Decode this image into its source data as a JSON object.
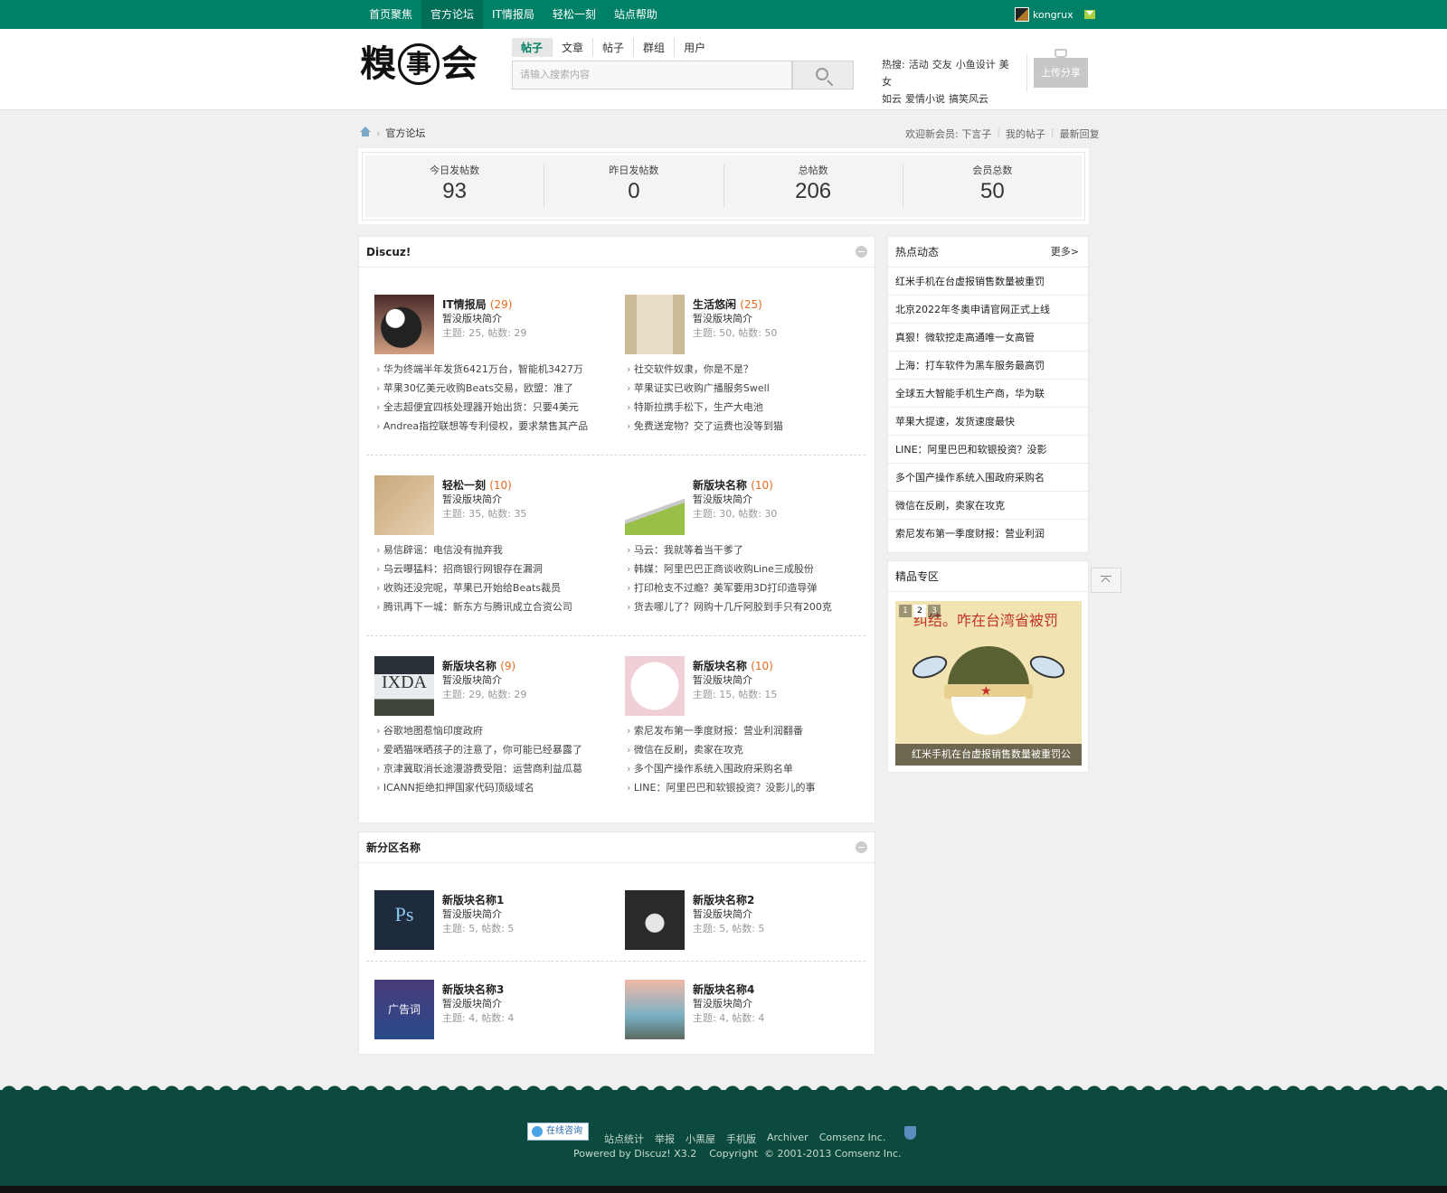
{
  "topnav": {
    "items": [
      "首页聚焦",
      "官方论坛",
      "IT情报局",
      "轻松一刻",
      "站点帮助"
    ],
    "active_index": 1,
    "username": "kongrux"
  },
  "header": {
    "logo_chars": [
      "糗",
      "事",
      "会"
    ],
    "search_tabs": [
      "帖子",
      "文章",
      "帖子",
      "群组",
      "用户"
    ],
    "search_placeholder": "请输入搜索内容",
    "hot_label": "热搜:",
    "hot_terms": [
      "活动",
      "交友",
      "小鱼设计",
      "美女",
      "如云",
      "爱情小说",
      "搞笑风云"
    ],
    "upload_label": "上传分享"
  },
  "breadcrumb": {
    "current": "官方论坛",
    "welcome": "欢迎新会员: 下言子",
    "my_posts": "我的帖子",
    "latest_replies": "最新回复"
  },
  "stats": [
    {
      "label": "今日发帖数",
      "value": "93"
    },
    {
      "label": "昨日发帖数",
      "value": "0"
    },
    {
      "label": "总帖数",
      "value": "206"
    },
    {
      "label": "会员总数",
      "value": "50"
    }
  ],
  "discuz": {
    "title": "Discuz!",
    "forums": [
      {
        "name": "IT情报局",
        "count": "(29)",
        "desc": "暂没版块简介",
        "meta": "主题: 25, 帖数: 29",
        "threads": [
          "华为终端半年发货6421万台，智能机3427万",
          "苹果30亿美元收购Beats交易，欧盟：准了",
          "全志超便宜四核处理器开始出货：只要4美元",
          "Andrea指控联想等专利侵权，要求禁售其产品"
        ]
      },
      {
        "name": "生活悠闲",
        "count": "(25)",
        "desc": "暂没版块简介",
        "meta": "主题: 50, 帖数: 50",
        "threads": [
          "社交软件奴隶，你是不是？",
          "苹果证实已收购广播服务Swell",
          "特斯拉携手松下，生产大电池",
          "免费送宠物？交了运费也没等到猫"
        ]
      },
      {
        "name": "轻松一刻",
        "count": "(10)",
        "desc": "暂没版块简介",
        "meta": "主题: 35, 帖数: 35",
        "threads": [
          "易信辟谣：电信没有抛弃我",
          "乌云曝猛料：招商银行网银存在漏洞",
          "收购还没完呢，苹果已开始给Beats裁员",
          "腾讯再下一城：新东方与腾讯成立合资公司"
        ]
      },
      {
        "name": "新版块名称",
        "count": "(10)",
        "desc": "暂没版块简介",
        "meta": "主题: 30, 帖数: 30",
        "threads": [
          "马云：我就等着当干爹了",
          "韩媒：阿里巴巴正商谈收购Line三成股份",
          "打印枪支不过瘾？美军要用3D打印造导弹",
          "货去哪儿了？网购十几斤阿胶到手只有200克"
        ]
      },
      {
        "name": "新版块名称",
        "count": "(9)",
        "desc": "暂没版块简介",
        "meta": "主题: 29, 帖数: 29",
        "threads": [
          "谷歌地图惹恼印度政府",
          "爱晒猫咪晒孩子的注意了，你可能已经暴露了",
          "京津冀取消长途漫游费受阻：运营商利益瓜葛",
          "ICANN拒绝扣押国家代码顶级域名"
        ]
      },
      {
        "name": "新版块名称",
        "count": "(10)",
        "desc": "暂没版块简介",
        "meta": "主题: 15, 帖数: 15",
        "threads": [
          "索尼发布第一季度财报：营业利润翻番",
          "微信在反刷，卖家在攻克",
          "多个国产操作系统入围政府采购名单",
          "LINE：阿里巴巴和软银投资？没影儿的事"
        ]
      }
    ]
  },
  "newzone": {
    "title": "新分区名称",
    "forums": [
      {
        "name": "新版块名称1",
        "desc": "暂没版块简介",
        "meta": "主题: 5, 帖数: 5",
        "thumb_text": "Ps"
      },
      {
        "name": "新版块名称2",
        "desc": "暂没版块简介",
        "meta": "主题: 5, 帖数: 5",
        "thumb_text": ""
      },
      {
        "name": "新版块名称3",
        "desc": "暂没版块简介",
        "meta": "主题: 4, 帖数: 4",
        "thumb_text": "广告词"
      },
      {
        "name": "新版块名称4",
        "desc": "暂没版块简介",
        "meta": "主题: 4, 帖数: 4",
        "thumb_text": ""
      }
    ]
  },
  "sidebar": {
    "hot_title": "热点动态",
    "more_label": "更多>",
    "hot_items": [
      "红米手机在台虚报销售数量被重罚",
      "北京2022年冬奥申请官网正式上线",
      "真狠！微软挖走高通唯一女高管",
      "上海：打车软件为黑车服务最高罚",
      "全球五大智能手机生产商，华为联",
      "苹果大提速，发货速度最快",
      "LINE：阿里巴巴和软银投资？没影",
      "多个国产操作系统入围政府采购名",
      "微信在反刷，卖家在攻克",
      "索尼发布第一季度财报：营业利润"
    ],
    "featured_title": "精品专区",
    "slide_headline": "纠结。咋在台湾省被罚",
    "slide_caption": "红米手机在台虚报销售数量被重罚公",
    "slide_pages": [
      "1",
      "2",
      "3"
    ]
  },
  "footer": {
    "online_label": "在线咨询",
    "links": [
      "站点统计",
      "举报",
      "小黑屋",
      "手机版",
      "Archiver",
      "Comsenz Inc."
    ],
    "copyright": "Powered by Discuz! X3.2    Copyright  © 2001-2013 Comsenz Inc."
  },
  "colors": {
    "brand": "#008066",
    "footer": "#0d4a3e",
    "count": "#e56a1e"
  }
}
